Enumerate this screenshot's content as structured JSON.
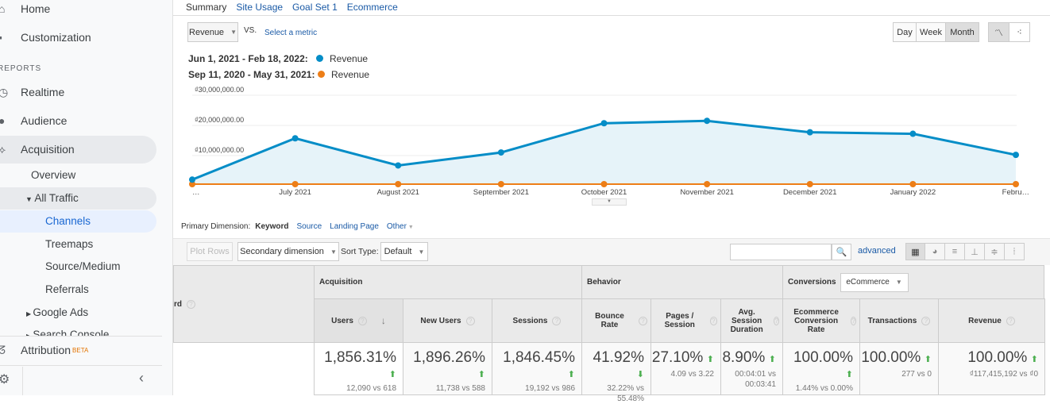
{
  "sidebar": {
    "home": "Home",
    "customization": "Customization",
    "reports_heading": "REPORTS",
    "realtime": "Realtime",
    "audience": "Audience",
    "acquisition": "Acquisition",
    "overview": "Overview",
    "all_traffic": "All Traffic",
    "channels": "Channels",
    "treemaps": "Treemaps",
    "source_medium": "Source/Medium",
    "referrals": "Referrals",
    "google_ads": "Google Ads",
    "search_console": "Search Console",
    "attribution": "Attribution",
    "beta": "BETA"
  },
  "tabs": [
    "Summary",
    "Site Usage",
    "Goal Set 1",
    "Ecommerce"
  ],
  "chart_controls": {
    "metric": "Revenue",
    "vs": "VS.",
    "select_metric": "Select a metric",
    "day": "Day",
    "week": "Week",
    "month": "Month",
    "active": "Month"
  },
  "legend": [
    {
      "range": "Jun 1, 2021 - Feb 18, 2022:",
      "label": "Revenue",
      "color": "#058dc7"
    },
    {
      "range": "Sep 11, 2020 - May 31, 2021:",
      "label": "Revenue",
      "color": "#ed7e17"
    }
  ],
  "chart_data": {
    "type": "area",
    "categories": [
      "…",
      "July 2021",
      "August 2021",
      "September 2021",
      "October 2021",
      "November 2021",
      "December 2021",
      "January 2022",
      "Febru…"
    ],
    "y_ticks": [
      "₫30,000,000.00",
      "₫20,000,000.00",
      "₫10,000,000.00"
    ],
    "ylim": [
      0,
      30000000
    ],
    "series": [
      {
        "name": "Revenue",
        "period": "Jun 1, 2021 - Feb 18, 2022",
        "color": "#058dc7",
        "values": [
          1500000,
          15200000,
          6200000,
          10500000,
          20200000,
          21000000,
          17200000,
          16700000,
          9700000
        ]
      },
      {
        "name": "Revenue",
        "period": "Sep 11, 2020 - May 31, 2021",
        "color": "#ed7e17",
        "values": [
          0,
          0,
          0,
          0,
          0,
          0,
          0,
          0,
          0
        ]
      }
    ],
    "grid": true
  },
  "dimension": {
    "label": "Primary Dimension:",
    "active": "Keyword",
    "options": [
      "Source",
      "Landing Page",
      "Other"
    ]
  },
  "toolbar": {
    "plot_rows": "Plot Rows",
    "secondary": "Secondary dimension",
    "sort_type": "Sort Type:",
    "sort_value": "Default",
    "search_value": "",
    "advanced": "advanced"
  },
  "table": {
    "first_col": "rd",
    "groups": {
      "acquisition": "Acquisition",
      "behavior": "Behavior",
      "conversions": "Conversions",
      "conv_select": "eCommerce"
    },
    "columns": [
      {
        "label": "Users",
        "pct": "1,856.31%",
        "cmp": "12,090 vs 618",
        "dir": "up"
      },
      {
        "label": "New Users",
        "pct": "1,896.26%",
        "cmp": "11,738 vs 588",
        "dir": "up"
      },
      {
        "label": "Sessions",
        "pct": "1,846.45%",
        "cmp": "19,192 vs 986",
        "dir": "up"
      },
      {
        "label": "Bounce Rate",
        "pct": "41.92%",
        "cmp": "32.22% vs 55.48%",
        "dir": "down"
      },
      {
        "label": "Pages / Session",
        "pct": "27.10%",
        "cmp": "4.09 vs 3.22",
        "dir": "up"
      },
      {
        "label": "Avg. Session Duration",
        "pct": "8.90%",
        "cmp": "00:04:01 vs 00:03:41",
        "dir": "up"
      },
      {
        "label": "Ecommerce Conversion Rate",
        "pct": "100.00%",
        "cmp": "1.44% vs 0.00%",
        "dir": "up"
      },
      {
        "label": "Transactions",
        "pct": "100.00%",
        "cmp": "277 vs 0",
        "dir": "up"
      },
      {
        "label": "Revenue",
        "pct": "100.00%",
        "cmp": "₫117,415,192 vs ₫0",
        "dir": "up"
      }
    ]
  }
}
